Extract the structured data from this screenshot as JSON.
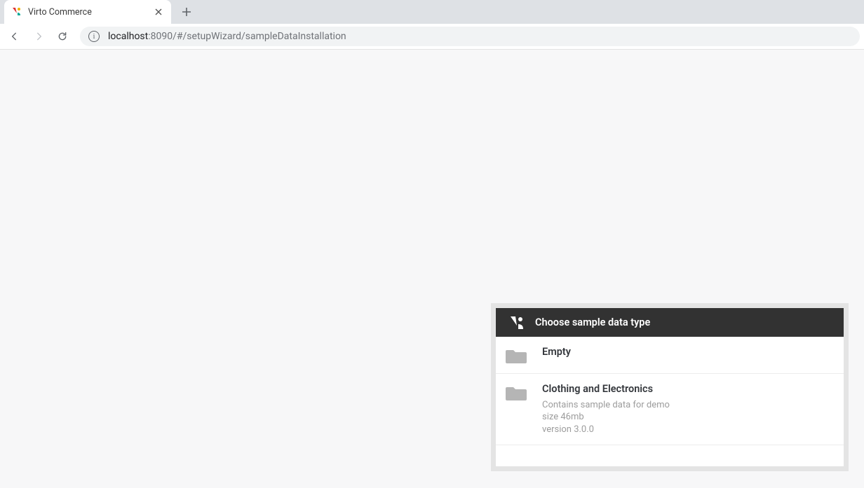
{
  "browser": {
    "tab_title": "Virto Commerce",
    "url_host": "localhost",
    "url_port": ":8090",
    "url_path": "/#/setupWizard/sampleDataInstallation"
  },
  "wizard": {
    "title": "Choose sample data type",
    "options": [
      {
        "title": "Empty",
        "desc_line1": "",
        "desc_line2": "",
        "desc_line3": ""
      },
      {
        "title": "Clothing and Electronics",
        "desc_line1": "Contains sample data for demo",
        "desc_line2": "size 46mb",
        "desc_line3": "version 3.0.0"
      }
    ]
  }
}
